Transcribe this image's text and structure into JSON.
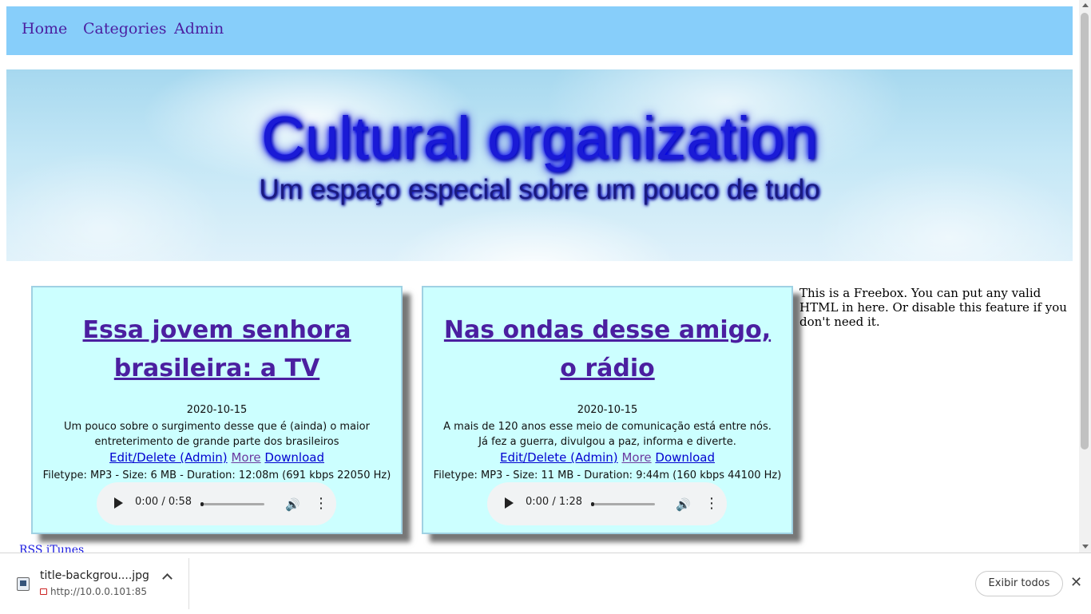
{
  "nav": {
    "items": [
      {
        "label": "Home"
      },
      {
        "label": "Categories"
      },
      {
        "label": "Admin"
      }
    ]
  },
  "header": {
    "title": "Cultural organization",
    "subtitle": "Um espaço especial sobre um pouco de tudo"
  },
  "posts": [
    {
      "title": "Essa jovem senhora brasileira: a TV",
      "date": "2020-10-15",
      "description": "Um pouco sobre o surgimento desse que é (ainda) o maior entreterimento de grande parte dos brasileiros",
      "edit_label": "Edit/Delete (Admin)",
      "more_label": "More",
      "download_label": "Download",
      "filetype": "Filetype: MP3 - Size: 6 MB - Duration: 12:08m (691 kbps 22050 Hz)",
      "player_time": "0:00 / 0:58"
    },
    {
      "title": "Nas ondas desse amigo, o rádio",
      "date": "2020-10-15",
      "description": "A mais de 120 anos esse meio de comunicação está entre nós. Já fez a guerra, divulgou a paz, informa e diverte.",
      "edit_label": "Edit/Delete (Admin)",
      "more_label": "More",
      "download_label": "Download",
      "filetype": "Filetype: MP3 - Size: 11 MB - Duration: 9:44m (160 kbps 44100 Hz)",
      "player_time": "0:00 / 1:28"
    }
  ],
  "freebox": {
    "text": "This is a Freebox. You can put any valid HTML in here. Or disable this feature if you don't need it."
  },
  "footer": {
    "rss_label": "RSS iTunes"
  },
  "download_bar": {
    "filename": "title-backgrou....jpg",
    "url": "http://10.0.0.101:85",
    "show_all_label": "Exibir todos",
    "close_icon": "close-icon"
  },
  "colors": {
    "nav_bg": "#87cefa",
    "card_bg": "#ccffff",
    "link_visited": "#4b1fa0",
    "link": "#0000d0"
  }
}
